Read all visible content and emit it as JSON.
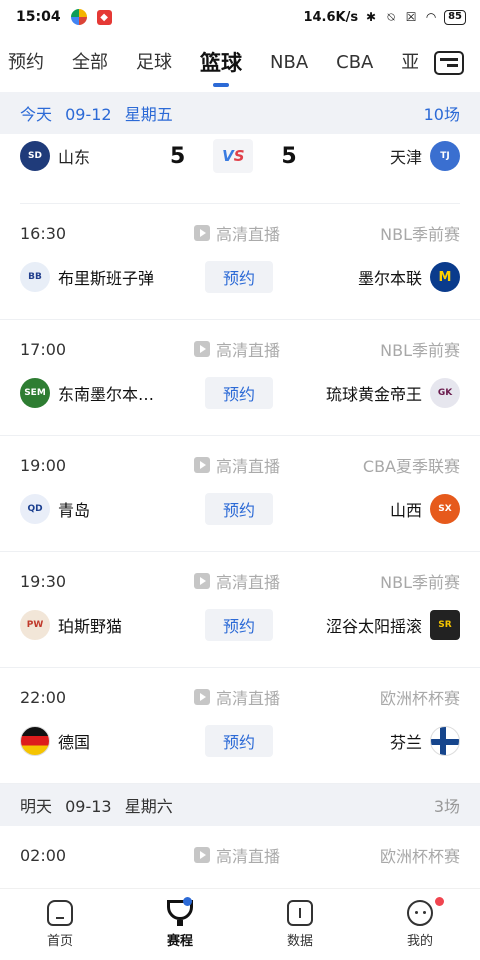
{
  "status": {
    "time": "15:04",
    "speed": "14.6K/s",
    "battery": "85"
  },
  "tabs": [
    "预约",
    "全部",
    "足球",
    "篮球",
    "NBA",
    "CBA",
    "亚洲"
  ],
  "active_tab_index": 3,
  "today": {
    "day": "今天",
    "date": "09-12",
    "weekday": "星期五",
    "count": "10场"
  },
  "live_match": {
    "home": "山东",
    "away": "天津",
    "home_score": "5",
    "away_score": "5",
    "vs_v": "V",
    "vs_s": "S"
  },
  "matches": [
    {
      "time": "16:30",
      "stream": "高清直播",
      "league": "NBL季前赛",
      "home": "布里斯班子弹",
      "away": "墨尔本联",
      "action": "预约"
    },
    {
      "time": "17:00",
      "stream": "高清直播",
      "league": "NBL季前赛",
      "home": "东南墨尔本…",
      "away": "琉球黄金帝王",
      "action": "预约"
    },
    {
      "time": "19:00",
      "stream": "高清直播",
      "league": "CBA夏季联赛",
      "home": "青岛",
      "away": "山西",
      "action": "预约"
    },
    {
      "time": "19:30",
      "stream": "高清直播",
      "league": "NBL季前赛",
      "home": "珀斯野猫",
      "away": "涩谷太阳摇滚",
      "action": "预约"
    },
    {
      "time": "22:00",
      "stream": "高清直播",
      "league": "欧洲杯杯赛",
      "home": "德国",
      "away": "芬兰",
      "action": "预约"
    }
  ],
  "tomorrow": {
    "day": "明天",
    "date": "09-13",
    "weekday": "星期六",
    "count": "3场"
  },
  "next_match": {
    "time": "02:00",
    "stream": "高清直播",
    "league": "欧洲杯杯赛"
  },
  "bottom_nav": [
    {
      "label": "首页",
      "icon": "home-icon"
    },
    {
      "label": "赛程",
      "icon": "trophy-icon"
    },
    {
      "label": "数据",
      "icon": "data-icon"
    },
    {
      "label": "我的",
      "icon": "profile-icon"
    }
  ],
  "colors": {
    "accent": "#2c6ad6",
    "date_bg": "#f0f2f6",
    "muted": "#a8a8a8",
    "badge": "#f0454f"
  }
}
